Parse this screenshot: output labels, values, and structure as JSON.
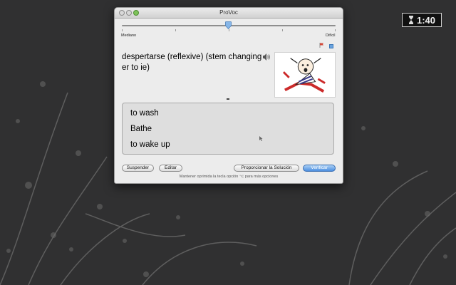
{
  "clock": {
    "time": "1:40"
  },
  "window": {
    "title": "ProVoc"
  },
  "difficulty": {
    "left_label": "Mediano",
    "right_label": "Difícil",
    "level_fraction": 0.5
  },
  "question": {
    "text": "despertarse (reflexive) (stem changing er to ie)"
  },
  "answers": [
    "to wash",
    "Bathe",
    "to wake up"
  ],
  "buttons": {
    "suspend": "Suspender",
    "edit": "Editar",
    "solution": "Proporcionar la Solución",
    "verify": "Verificar"
  },
  "hint": "Mantener oprimida la tecla opción ⌥ para más opciones",
  "colors": {
    "verify_button": "#4d8fe0",
    "desktop": "#2f2f30"
  }
}
